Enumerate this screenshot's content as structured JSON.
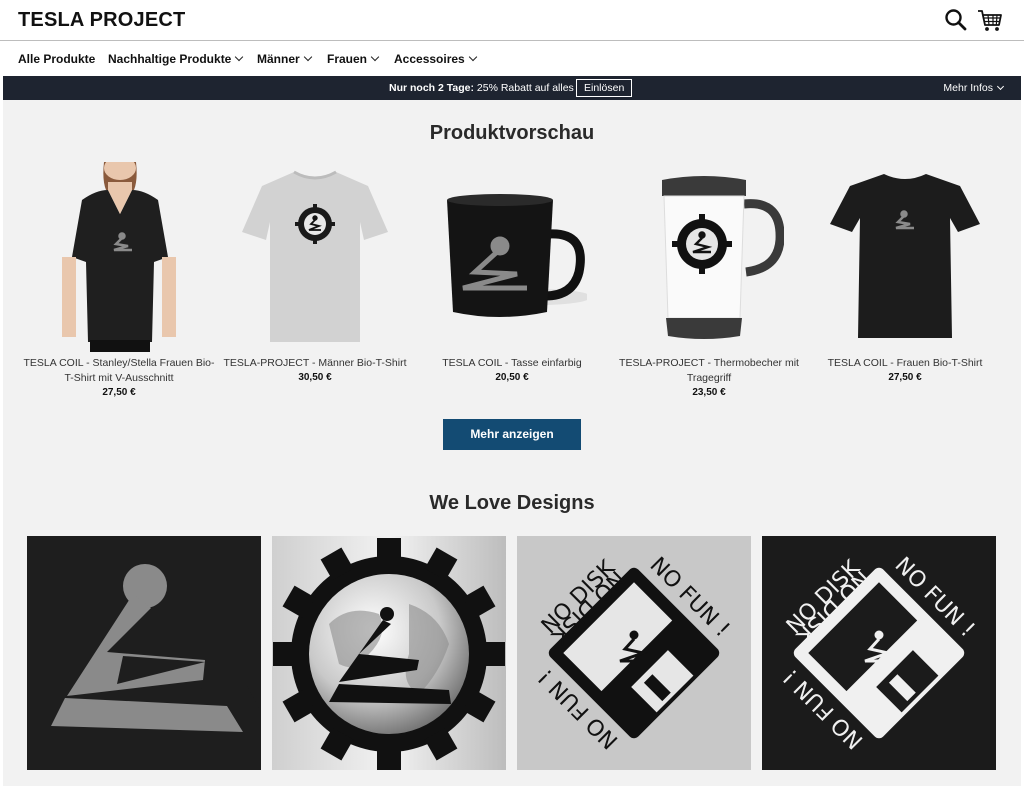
{
  "header": {
    "brand": "TESLA PROJECT",
    "icons": [
      "search-icon",
      "cart-icon"
    ]
  },
  "nav": {
    "items": [
      {
        "label": "Alle Produkte",
        "dropdown": false
      },
      {
        "label": "Nachhaltige Produkte",
        "dropdown": true
      },
      {
        "label": "Männer",
        "dropdown": true
      },
      {
        "label": "Frauen",
        "dropdown": true
      },
      {
        "label": "Accessoires",
        "dropdown": true
      }
    ]
  },
  "promo": {
    "bold": "Nur noch 2 Tage:",
    "text": "25% Rabatt auf alles",
    "button": "Einlösen",
    "more": "Mehr Infos"
  },
  "products_section": {
    "title": "Produktvorschau",
    "items": [
      {
        "name": "TESLA COIL - Stanley/Stella Frauen Bio-T-Shirt mit V-Ausschnitt",
        "price": "27,50 €",
        "image": "woman-vneck-shirt"
      },
      {
        "name": "TESLA-PROJECT - Männer Bio-T-Shirt",
        "price": "30,50 €",
        "image": "grey-tshirt"
      },
      {
        "name": "TESLA COIL - Tasse einfarbig",
        "price": "20,50 €",
        "image": "black-mug"
      },
      {
        "name": "TESLA-PROJECT - Thermobecher mit Tragegriff",
        "price": "23,50 €",
        "image": "thermo-mug"
      },
      {
        "name": "TESLA COIL - Frauen Bio-T-Shirt",
        "price": "27,50 €",
        "image": "black-women-tshirt"
      }
    ],
    "more_button": "Mehr anzeigen"
  },
  "designs_section": {
    "title": "We Love Designs",
    "items": [
      {
        "image": "tesla-coil-logo-grey"
      },
      {
        "image": "tesla-globe-gear"
      },
      {
        "image": "no-disk-no-fun-light",
        "text": [
          "NO DISK",
          "NO FUN !"
        ]
      },
      {
        "image": "no-disk-no-fun-dark",
        "text": [
          "NO DISK",
          "NO FUN !"
        ]
      }
    ]
  },
  "colors": {
    "promo_bg": "#1e2430",
    "button_bg": "#134b73",
    "page_bg": "#f2f2f2"
  }
}
